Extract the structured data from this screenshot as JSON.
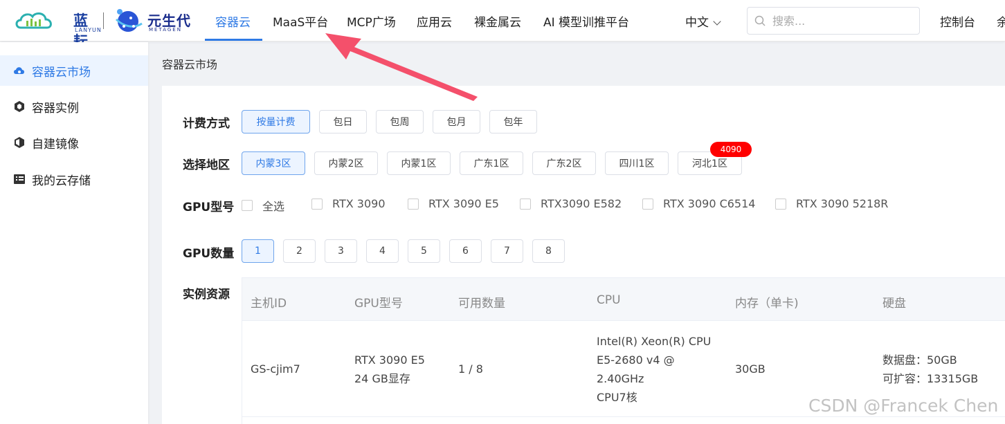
{
  "brand": {
    "lanyun_cn": "蓝耘",
    "lanyun_en": "LANYUN",
    "metagen_cn": "元生代",
    "metagen_en": "METAGEN"
  },
  "nav": {
    "items": [
      "容器云",
      "MaaS平台",
      "MCP广场",
      "应用云",
      "裸金属云",
      "AI 模型训推平台"
    ],
    "active_index": 0,
    "language": "中文",
    "search_placeholder": "搜索...",
    "console": "控制台",
    "more": "余"
  },
  "sidebar": {
    "items": [
      {
        "label": "容器云市场",
        "icon": "cloud-icon"
      },
      {
        "label": "容器实例",
        "icon": "cube-icon"
      },
      {
        "label": "自建镜像",
        "icon": "image-box-icon"
      },
      {
        "label": "我的云存储",
        "icon": "storage-list-icon"
      }
    ],
    "active_index": 0
  },
  "breadcrumb": "容器云市场",
  "billing": {
    "label": "计费方式",
    "options": [
      "按量计费",
      "包日",
      "包周",
      "包月",
      "包年"
    ],
    "selected": "按量计费"
  },
  "region": {
    "label": "选择地区",
    "options": [
      "内蒙3区",
      "内蒙2区",
      "内蒙1区",
      "广东1区",
      "广东2区",
      "四川1区",
      "河北1区"
    ],
    "selected": "内蒙3区",
    "badge": "4090"
  },
  "gpu_model": {
    "label": "GPU型号",
    "options": [
      "全选",
      "RTX 3090",
      "RTX 3090 E5",
      "RTX3090 E582",
      "RTX 3090 C6514",
      "RTX 3090 5218R"
    ]
  },
  "gpu_count": {
    "label": "GPU数量",
    "options": [
      "1",
      "2",
      "3",
      "4",
      "5",
      "6",
      "7",
      "8"
    ],
    "selected": "1"
  },
  "resources": {
    "label": "实例资源",
    "columns": [
      "主机ID",
      "GPU型号",
      "可用数量",
      "CPU",
      "内存（单卡)",
      "硬盘"
    ],
    "rows": [
      {
        "host_id": "GS-cjim7",
        "gpu_model": [
          "RTX 3090 E5",
          "24 GB显存"
        ],
        "available": "1 / 8",
        "cpu": [
          "Intel(R) Xeon(R) CPU",
          "E5-2680 v4 @",
          "2.40GHz",
          "CPU7核"
        ],
        "memory": "30GB",
        "disk": [
          "数据盘：50GB",
          "可扩容：13315GB"
        ]
      }
    ]
  },
  "watermark": "CSDN @Francek Chen",
  "colors": {
    "accent": "#2f7ae5",
    "selected_bg": "#ecf4ff",
    "annotation_arrow": "#f4506b",
    "badge": "#ff0000"
  }
}
